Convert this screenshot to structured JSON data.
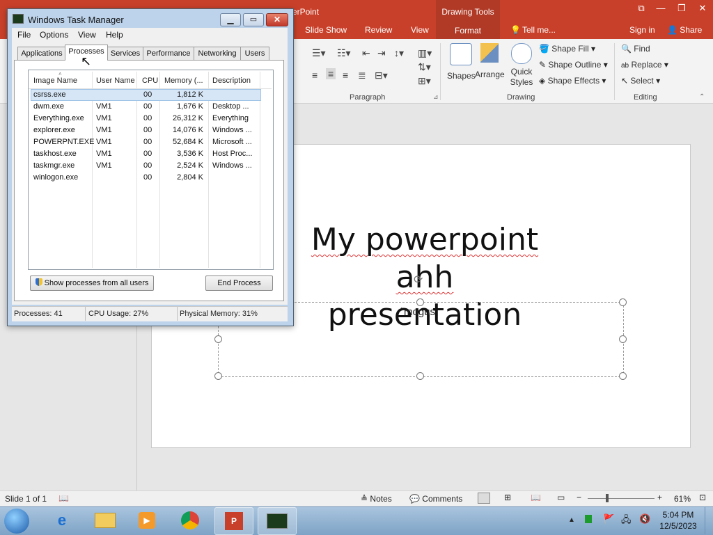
{
  "powerpoint": {
    "title_fragment": "erPoint",
    "drawing_tools": "Drawing Tools",
    "tabs": [
      "Slide Show",
      "Review",
      "View",
      "Format"
    ],
    "tell_me": "Tell me...",
    "sign_in": "Sign in",
    "share": "Share",
    "ribbon": {
      "paragraph_label": "Paragraph",
      "drawing_label": "Drawing",
      "editing_label": "Editing",
      "shapes": "Shapes",
      "arrange": "Arrange",
      "quick_styles": "Quick Styles",
      "shape_fill": "Shape Fill",
      "shape_outline": "Shape Outline",
      "shape_effects": "Shape Effects",
      "find": "Find",
      "replace": "Replace",
      "select": "Select"
    },
    "slide": {
      "title_line1": "My powerpoint ahh",
      "title_line2": "presentation",
      "subtitle": "`mogus"
    },
    "status": {
      "slide": "Slide 1 of 1",
      "notes": "Notes",
      "comments": "Comments",
      "zoom": "61%"
    }
  },
  "taskmanager": {
    "title": "Windows Task Manager",
    "menu": [
      "File",
      "Options",
      "View",
      "Help"
    ],
    "tabs": [
      "Applications",
      "Processes",
      "Services",
      "Performance",
      "Networking",
      "Users"
    ],
    "active_tab": "Processes",
    "columns": [
      "Image Name",
      "User Name",
      "CPU",
      "Memory (...",
      "Description"
    ],
    "rows": [
      {
        "name": "csrss.exe",
        "user": "",
        "cpu": "00",
        "mem": "1,812 K",
        "desc": ""
      },
      {
        "name": "dwm.exe",
        "user": "VM1",
        "cpu": "00",
        "mem": "1,676 K",
        "desc": "Desktop ..."
      },
      {
        "name": "Everything.exe",
        "user": "VM1",
        "cpu": "00",
        "mem": "26,312 K",
        "desc": "Everything"
      },
      {
        "name": "explorer.exe",
        "user": "VM1",
        "cpu": "00",
        "mem": "14,076 K",
        "desc": "Windows ..."
      },
      {
        "name": "POWERPNT.EXE",
        "user": "VM1",
        "cpu": "00",
        "mem": "52,684 K",
        "desc": "Microsoft ..."
      },
      {
        "name": "taskhost.exe",
        "user": "VM1",
        "cpu": "00",
        "mem": "3,536 K",
        "desc": "Host Proc..."
      },
      {
        "name": "taskmgr.exe",
        "user": "VM1",
        "cpu": "00",
        "mem": "2,524 K",
        "desc": "Windows ..."
      },
      {
        "name": "winlogon.exe",
        "user": "",
        "cpu": "00",
        "mem": "2,804 K",
        "desc": ""
      }
    ],
    "show_all_button": "Show processes from all users",
    "end_process_button": "End Process",
    "status": {
      "processes": "Processes: 41",
      "cpu": "CPU Usage: 27%",
      "memory": "Physical Memory: 31%"
    }
  },
  "taskbar": {
    "time": "5:04 PM",
    "date": "12/5/2023"
  },
  "colors": {
    "ppt_accent": "#c9402a",
    "taskbar": "#8fb0cf",
    "tm_frame": "#bcd3eb"
  }
}
